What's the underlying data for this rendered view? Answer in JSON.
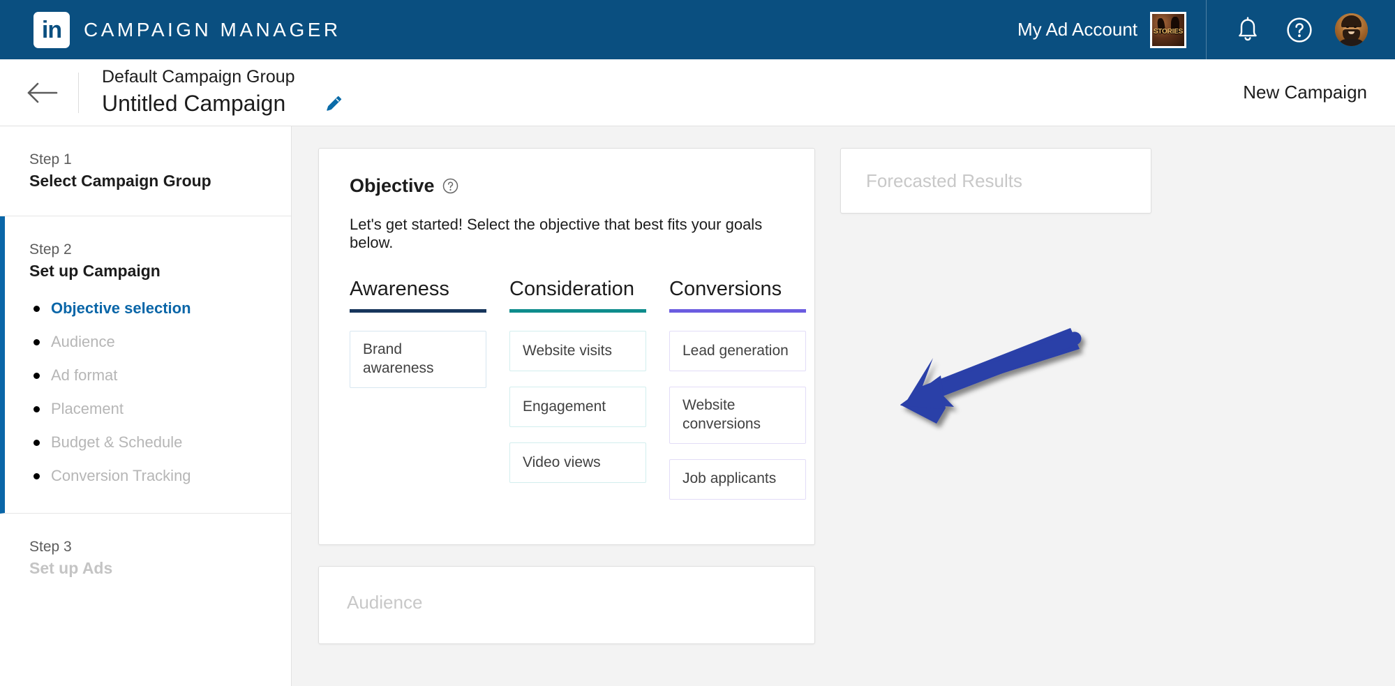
{
  "topnav": {
    "logo_icon": "linkedin-logo-icon",
    "logo_mark": "in",
    "brand": "CAMPAIGN MANAGER",
    "account_name": "My Ad Account",
    "account_thumb_label": "STORIES",
    "notifications_icon": "bell-icon",
    "help_icon": "question-circle-icon",
    "avatar_icon": "user-avatar",
    "background_color": "#0a4f80"
  },
  "subheader": {
    "back_icon": "back-arrow-icon",
    "group_name": "Default Campaign Group",
    "campaign_name": "Untitled Campaign",
    "edit_icon": "pencil-edit-icon",
    "edit_icon_color": "#0a6ba8",
    "new_campaign_label": "New Campaign"
  },
  "sidebar": {
    "steps": [
      {
        "label": "Step 1",
        "title": "Select Campaign Group",
        "active": false,
        "dim": false,
        "substeps": []
      },
      {
        "label": "Step 2",
        "title": "Set up Campaign",
        "active": true,
        "dim": false,
        "substeps": [
          {
            "label": "Objective selection",
            "current": true
          },
          {
            "label": "Audience",
            "current": false
          },
          {
            "label": "Ad format",
            "current": false
          },
          {
            "label": "Placement",
            "current": false
          },
          {
            "label": "Budget & Schedule",
            "current": false
          },
          {
            "label": "Conversion Tracking",
            "current": false
          }
        ]
      },
      {
        "label": "Step 3",
        "title": "Set up Ads",
        "active": false,
        "dim": true,
        "substeps": []
      }
    ],
    "active_accent_color": "#0a66a8",
    "current_link_color": "#0a66a8"
  },
  "objective": {
    "title": "Objective",
    "help_icon": "question-circle-icon",
    "subtitle": "Let's get started! Select the objective that best fits your goals below.",
    "columns": [
      {
        "title": "Awareness",
        "rule_color": "#17365c",
        "border_color": "#d7e6f0",
        "options": [
          {
            "label": "Brand awareness",
            "two_line": true
          }
        ]
      },
      {
        "title": "Consideration",
        "rule_color": "#0e8c8c",
        "border_color": "#d2eeee",
        "options": [
          {
            "label": "Website visits",
            "two_line": false
          },
          {
            "label": "Engagement",
            "two_line": false
          },
          {
            "label": "Video views",
            "two_line": false
          }
        ]
      },
      {
        "title": "Conversions",
        "rule_color": "#6b5ce0",
        "border_color": "#e2dcf7",
        "options": [
          {
            "label": "Lead generation",
            "two_line": false
          },
          {
            "label": "Website conversions",
            "two_line": true
          },
          {
            "label": "Job applicants",
            "two_line": false
          }
        ]
      }
    ]
  },
  "audience_panel": {
    "placeholder": "Audience"
  },
  "forecast_panel": {
    "placeholder": "Forecasted Results"
  },
  "annotation": {
    "arrow_color": "#2b3fa8",
    "points_at": "Lead generation"
  }
}
